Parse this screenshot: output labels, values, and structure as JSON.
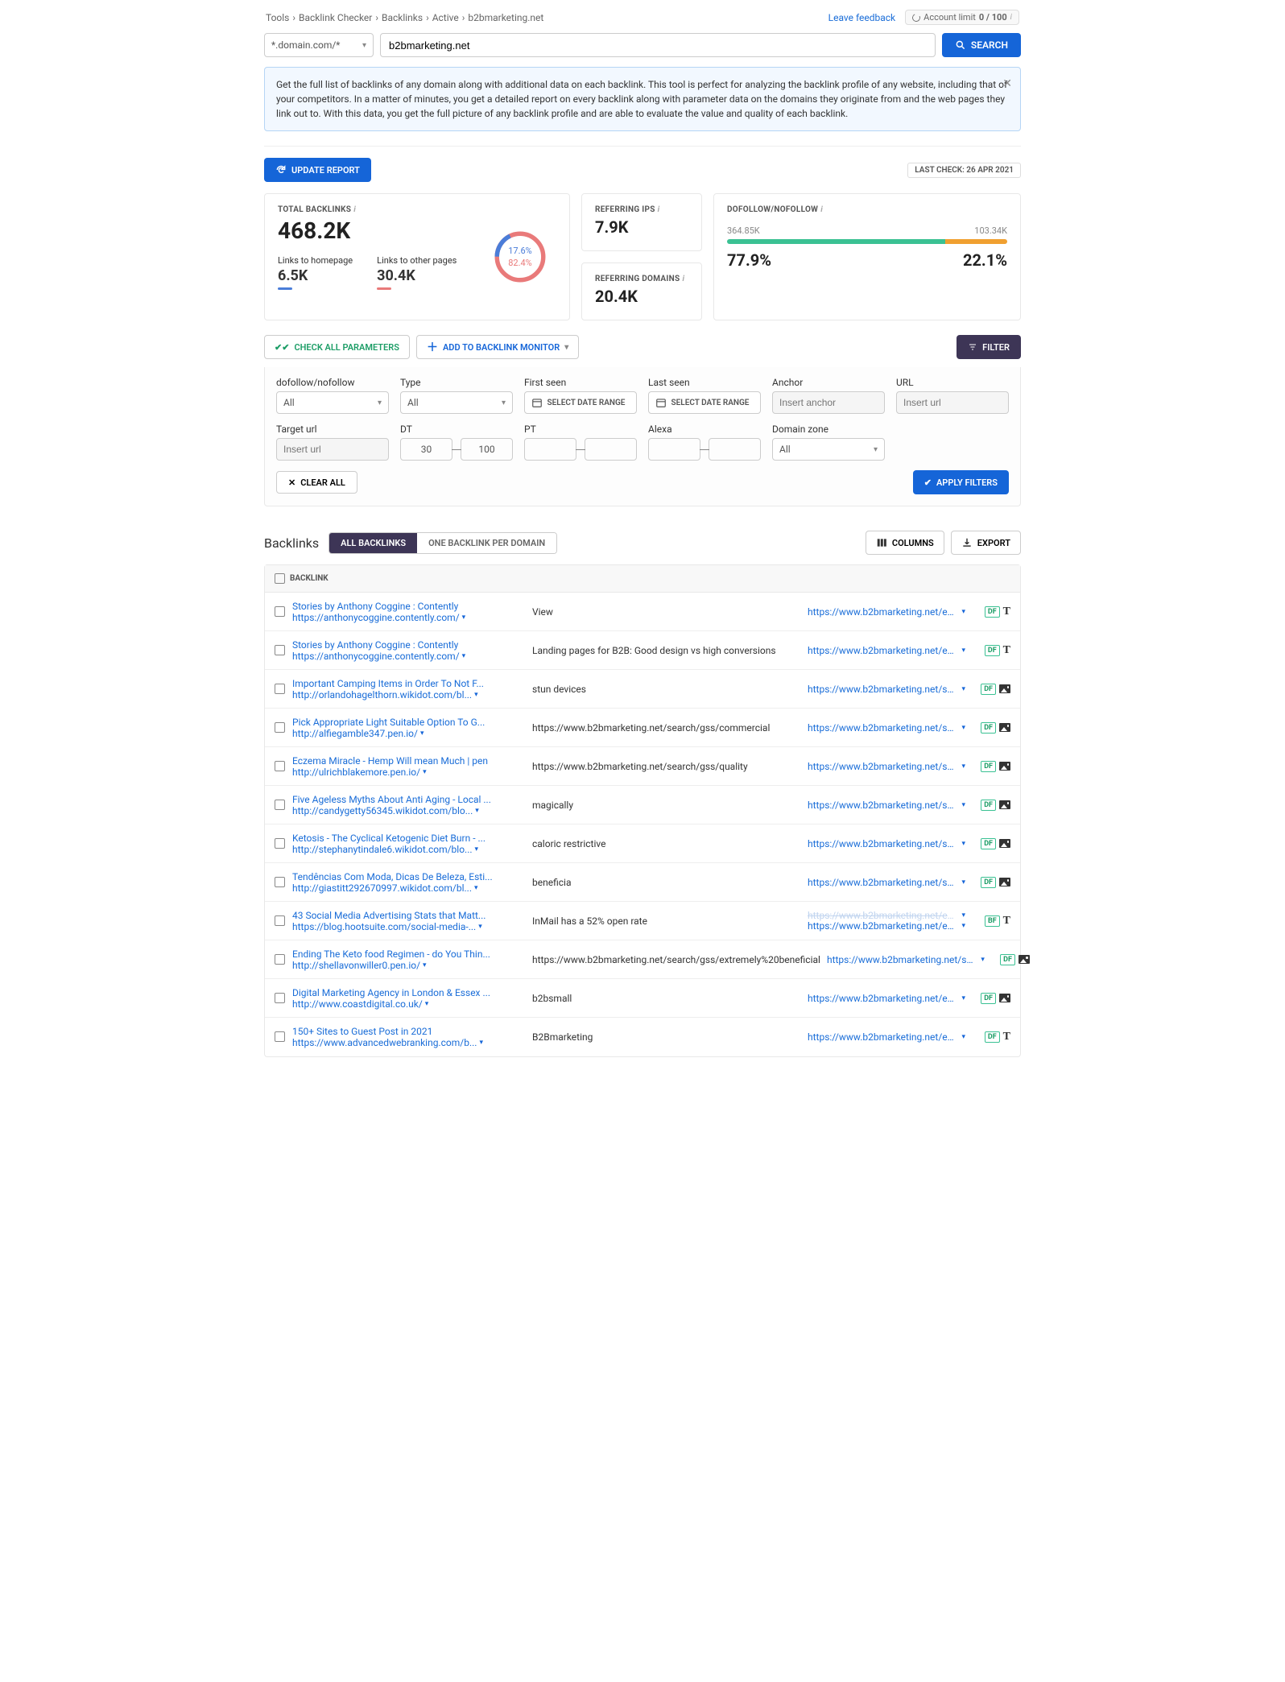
{
  "breadcrumb": {
    "p0": "Tools",
    "p1": "Backlink Checker",
    "p2": "Backlinks",
    "p3": "Active",
    "p4": "b2bmarketing.net"
  },
  "topright": {
    "feedback": "Leave feedback",
    "limit_label": "Account limit",
    "limit_val": "0 / 100"
  },
  "search": {
    "mode": "*.domain.com/*",
    "value": "b2bmarketing.net",
    "btn": "SEARCH"
  },
  "banner": {
    "text": "Get the full list of backlinks of any domain along with additional data on each backlink. This tool is perfect for analyzing the backlink profile of any website, including that of your competitors. In a matter of minutes, you get a detailed report on every backlink along with parameter data on the domains they originate from and the web pages they link out to. With this data, you get the full picture of any backlink profile and are able to evaluate the value and quality of each backlink."
  },
  "update": {
    "btn": "UPDATE REPORT",
    "lastcheck": "LAST CHECK: 26 APR 2021"
  },
  "stats": {
    "total_title": "TOTAL BACKLINKS",
    "total_val": "468.2K",
    "home_label": "Links to homepage",
    "home_val": "6.5K",
    "other_label": "Links to other pages",
    "other_val": "30.4K",
    "donut_blue": "17.6%",
    "donut_red": "82.4%",
    "refips_title": "REFERRING IPS",
    "refips_val": "7.9K",
    "refdom_title": "REFERRING DOMAINS",
    "refdom_val": "20.4K",
    "dofo_title": "DOFOLLOW/NOFOLLOW",
    "dofo_left_abs": "364.85K",
    "dofo_right_abs": "103.34K",
    "dofo_left_pct": "77.9%",
    "dofo_right_pct": "22.1%"
  },
  "actions": {
    "check": "CHECK ALL PARAMETERS",
    "add": "ADD TO BACKLINK MONITOR",
    "filter": "FILTER"
  },
  "filters": {
    "dofollow_label": "dofollow/nofollow",
    "dofollow_val": "All",
    "type_label": "Type",
    "type_val": "All",
    "first_label": "First seen",
    "last_label": "Last seen",
    "date_txt": "SELECT DATE RANGE",
    "anchor_label": "Anchor",
    "anchor_ph": "Insert anchor",
    "url_label": "URL",
    "url_ph": "Insert url",
    "target_label": "Target url",
    "target_ph": "Insert url",
    "dt_label": "DT",
    "dt_min": "30",
    "dt_max": "100",
    "pt_label": "PT",
    "alexa_label": "Alexa",
    "zone_label": "Domain zone",
    "zone_val": "All",
    "clear": "CLEAR ALL",
    "apply": "APPLY FILTERS"
  },
  "blhead": {
    "title": "Backlinks",
    "seg1": "ALL BACKLINKS",
    "seg2": "ONE BACKLINK PER DOMAIN",
    "columns": "COLUMNS",
    "export": "EXPORT",
    "th": "BACKLINK"
  },
  "rows": [
    {
      "title": "Stories by Anthony Coggine : Contently",
      "url": "https://anthonycoggine.contently.com/",
      "anchor": "View",
      "target": "https://www.b2bmarketing.net/en-gb...",
      "tag": "DF",
      "type": "T"
    },
    {
      "title": "Stories by Anthony Coggine : Contently",
      "url": "https://anthonycoggine.contently.com/",
      "anchor": "Landing pages for B2B: Good design vs high conversions",
      "target": "https://www.b2bmarketing.net/en-gb...",
      "tag": "DF",
      "type": "T"
    },
    {
      "title": "Important Camping Items in Order To Not F...",
      "url": "http://orlandohagelthorn.wikidot.com/bl...",
      "anchor": "stun devices",
      "target": "https://www.b2bmarketing.net/search...",
      "tag": "DF",
      "type": "I"
    },
    {
      "title": "Pick Appropriate Light Suitable Option To G...",
      "url": "http://alfiegamble347.pen.io/",
      "anchor": "https://www.b2bmarketing.net/search/gss/commercial",
      "target": "https://www.b2bmarketing.net/search...",
      "tag": "DF",
      "type": "I"
    },
    {
      "title": "Eczema Miracle - Hemp Will mean Much | pen",
      "url": "http://ulrichblakemore.pen.io/",
      "anchor": "https://www.b2bmarketing.net/search/gss/quality",
      "target": "https://www.b2bmarketing.net/search...",
      "tag": "DF",
      "type": "I"
    },
    {
      "title": "Five Ageless Myths About Anti Aging - Local ...",
      "url": "http://candygetty56345.wikidot.com/blo...",
      "anchor": "magically",
      "target": "https://www.b2bmarketing.net/search...",
      "tag": "DF",
      "type": "I"
    },
    {
      "title": "Ketosis - The Cyclical Ketogenic Diet Burn - ...",
      "url": "http://stephanytindale6.wikidot.com/blo...",
      "anchor": "caloric restrictive",
      "target": "https://www.b2bmarketing.net/search...",
      "tag": "DF",
      "type": "I"
    },
    {
      "title": "Tendências Com Moda, Dicas De Beleza, Esti...",
      "url": "http://giastitt292670997.wikidot.com/bl...",
      "anchor": "beneficia",
      "target": "https://www.b2bmarketing.net/search...",
      "tag": "DF",
      "type": "I"
    },
    {
      "title": "43 Social Media Advertising Stats that Matt...",
      "url": "https://blog.hootsuite.com/social-media-...",
      "anchor": "InMail has a 52% open rate",
      "target": "https://www.b2bmarketing.net/en-gb...",
      "tag": "BF",
      "type": "T",
      "dbl": true,
      "target_strike": "https://www.b2bmarketing.net/en-gb..."
    },
    {
      "title": "Ending The Keto food Regimen - do You Thin...",
      "url": "http://shellavonwiller0.pen.io/",
      "anchor": "https://www.b2bmarketing.net/search/gss/extremely%20beneficial",
      "target": "https://www.b2bmarketing.net/search...",
      "tag": "DF",
      "type": "I"
    },
    {
      "title": "Digital Marketing Agency in London & Essex ...",
      "url": "http://www.coastdigital.co.uk/",
      "anchor": "b2bsmall",
      "target": "https://www.b2bmarketing.net/en-gb...",
      "tag": "DF",
      "type": "I"
    },
    {
      "title": "150+ Sites to Guest Post in 2021",
      "url": "https://www.advancedwebranking.com/b...",
      "anchor": "B2Bmarketing",
      "target": "https://www.b2bmarketing.net/en-gb...",
      "tag": "DF",
      "type": "T"
    }
  ]
}
